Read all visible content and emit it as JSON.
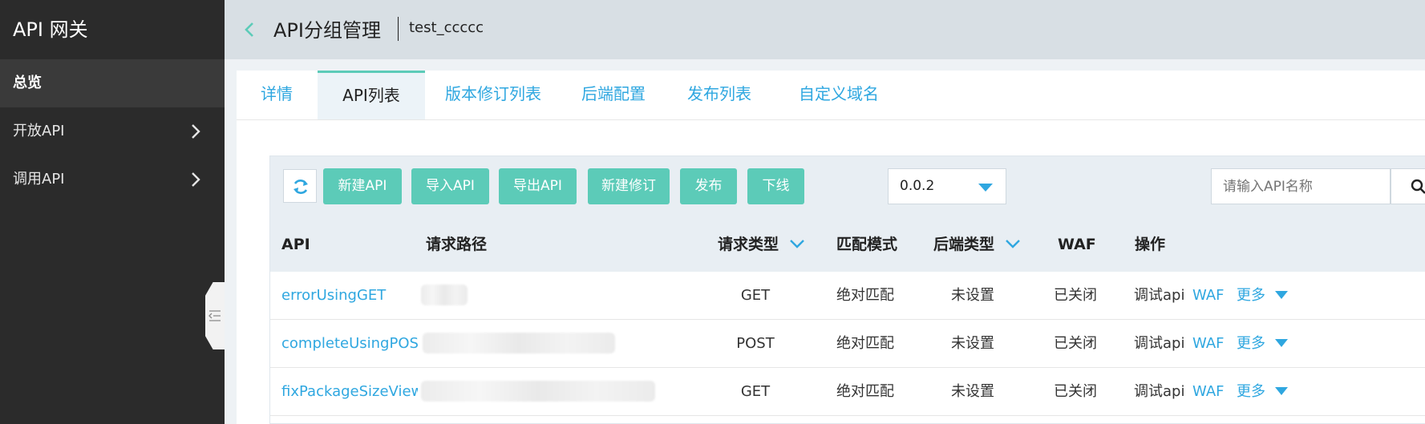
{
  "sidebar": {
    "title": "API 网关",
    "items": [
      {
        "label": "总览"
      },
      {
        "label": "开放API"
      },
      {
        "label": "调用API"
      }
    ]
  },
  "header": {
    "title": "API分组管理",
    "group_name": "test_ccccc"
  },
  "tabs": [
    {
      "label": "详情"
    },
    {
      "label": "API列表"
    },
    {
      "label": "版本修订列表"
    },
    {
      "label": "后端配置"
    },
    {
      "label": "发布列表"
    },
    {
      "label": "自定义域名"
    }
  ],
  "toolbar": {
    "new_api": "新建API",
    "import_api": "导入API",
    "export_api": "导出API",
    "new_revision": "新建修订",
    "publish": "发布",
    "offline": "下线",
    "version": "0.0.2",
    "search_placeholder": "请输入API名称"
  },
  "table": {
    "headers": {
      "api": "API",
      "path": "请求路径",
      "method": "请求类型",
      "match": "匹配模式",
      "backend": "后端类型",
      "waf": "WAF",
      "ops": "操作"
    },
    "rows": [
      {
        "api": "errorUsingGET",
        "method": "GET",
        "match": "绝对匹配",
        "backend": "未设置",
        "waf": "已关闭",
        "debug": "调试api",
        "waf_link": "WAF",
        "more": "更多"
      },
      {
        "api": "completeUsingPOST",
        "method": "POST",
        "match": "绝对匹配",
        "backend": "未设置",
        "waf": "已关闭",
        "debug": "调试api",
        "waf_link": "WAF",
        "more": "更多"
      },
      {
        "api": "fixPackageSizeViewUs",
        "method": "GET",
        "match": "绝对匹配",
        "backend": "未设置",
        "waf": "已关闭",
        "debug": "调试api",
        "waf_link": "WAF",
        "more": "更多"
      }
    ]
  },
  "colors": {
    "accent": "#5ccbb8",
    "link": "#2fa7e0",
    "sidebar_bg": "#2b2b2b"
  }
}
